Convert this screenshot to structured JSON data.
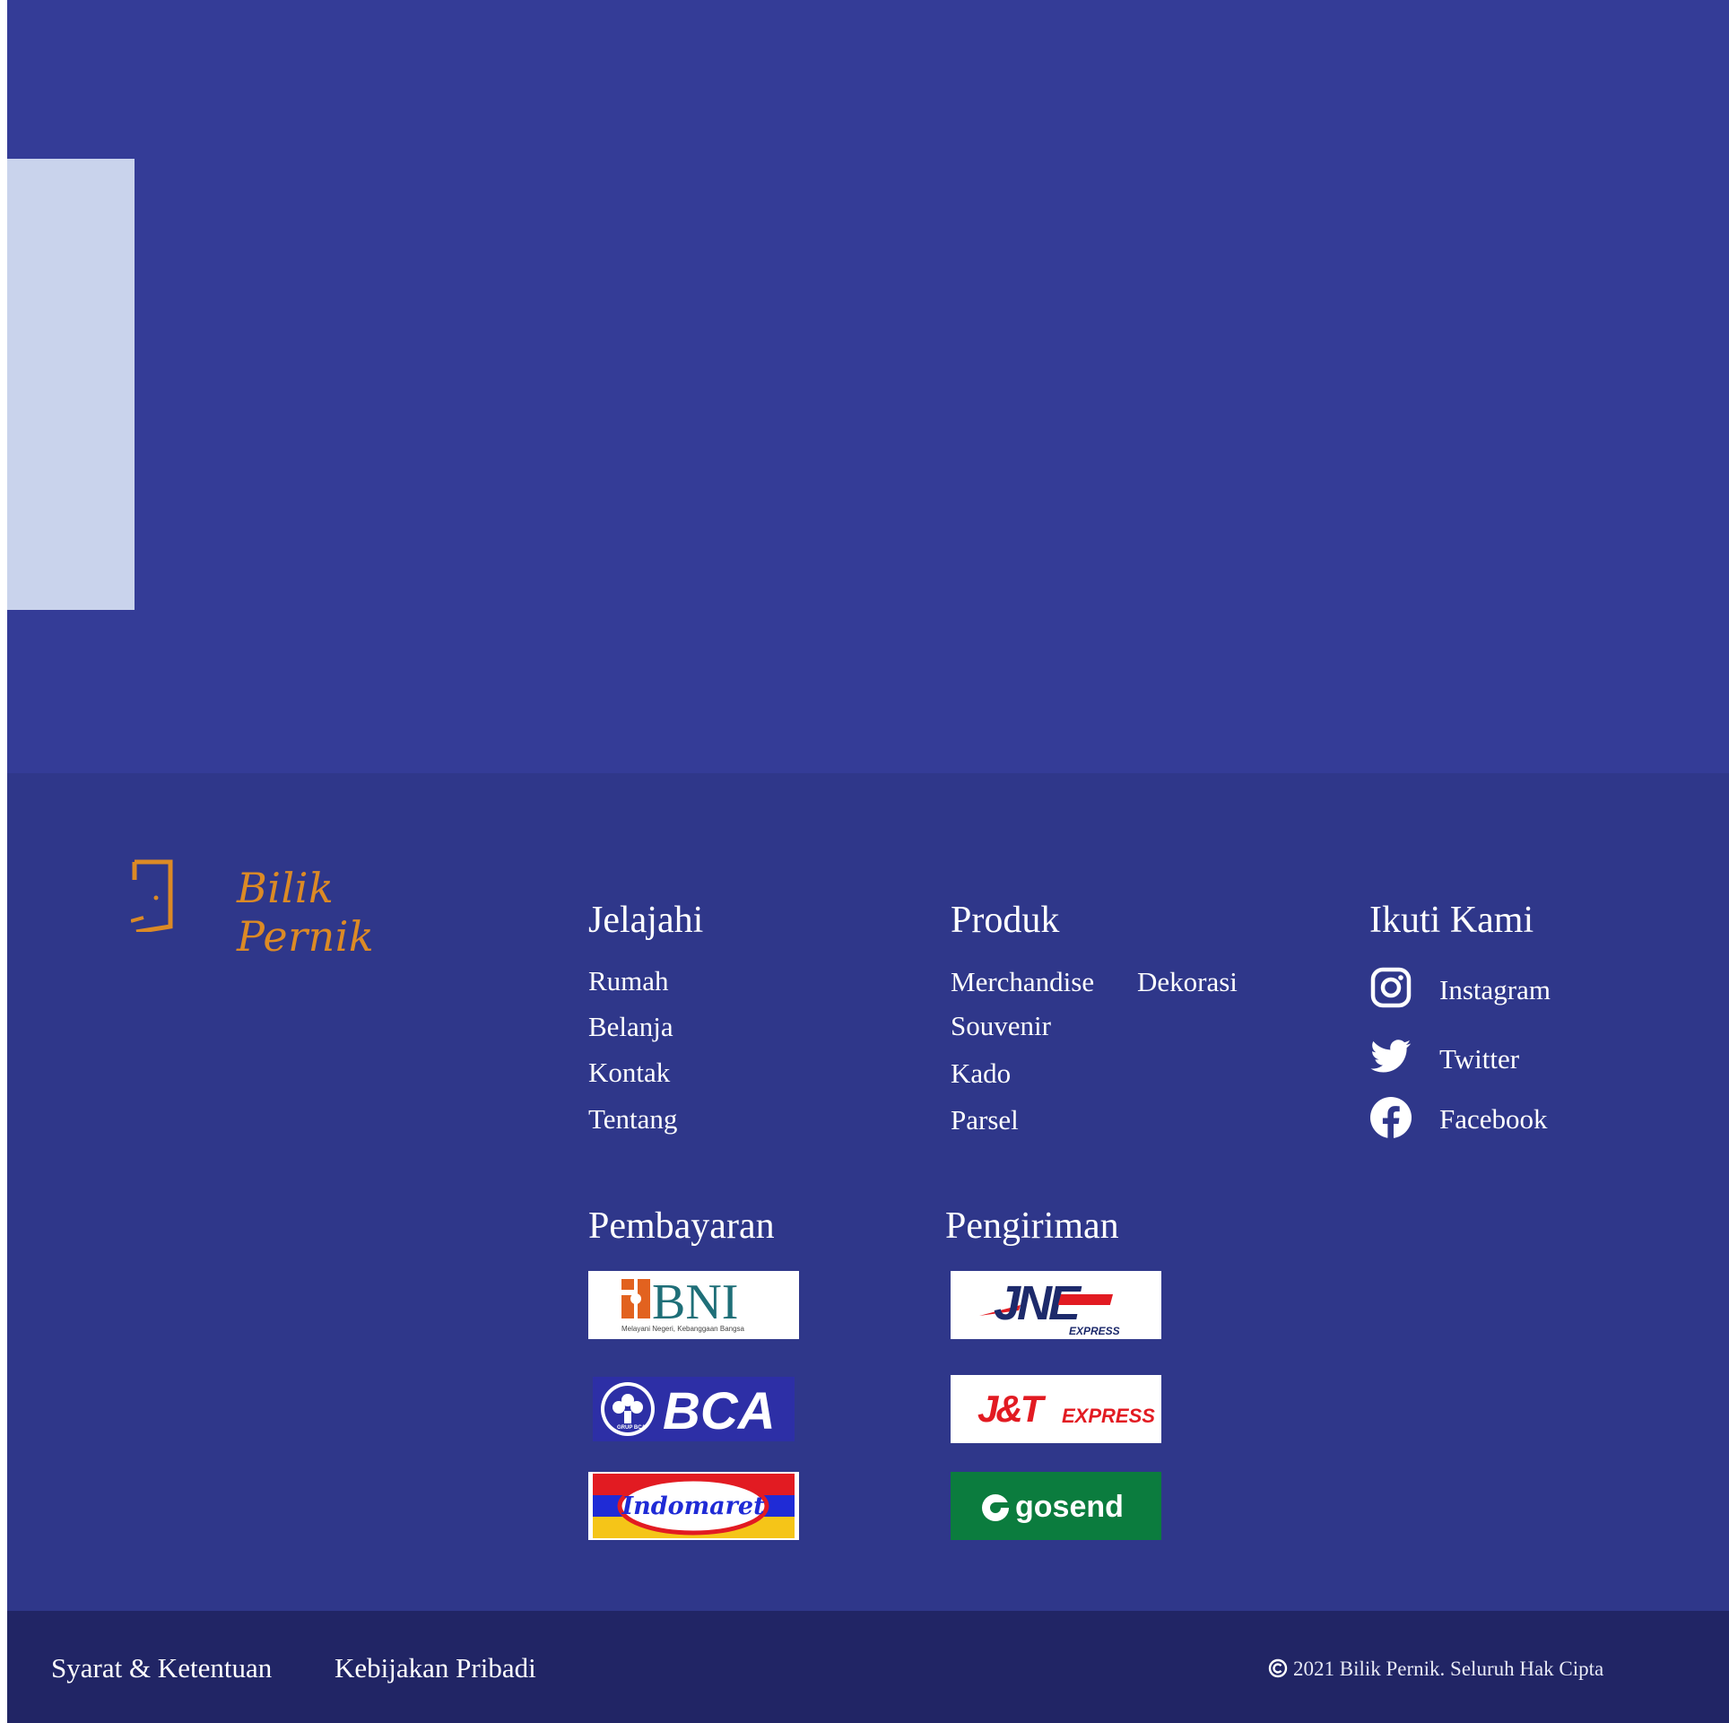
{
  "brand": {
    "name": "Bilik Pernik",
    "accent_color": "#dc8a25",
    "logo_icon": "door-icon"
  },
  "colors": {
    "hero_bg": "#343c97",
    "hero_panel": "#c9d3ec",
    "footer_bg": "#2f378a",
    "bottom_bar_bg": "#212565"
  },
  "explore": {
    "title": "Jelajahi",
    "links": [
      "Rumah",
      "Belanja",
      "Kontak",
      "Tentang"
    ]
  },
  "products": {
    "title": "Produk",
    "links": [
      "Merchandise",
      "Dekorasi",
      "Souvenir",
      "Kado",
      "Parsel"
    ]
  },
  "social": {
    "title": "Ikuti Kami",
    "items": [
      {
        "label": "Instagram",
        "icon": "instagram-icon"
      },
      {
        "label": "Twitter",
        "icon": "twitter-icon"
      },
      {
        "label": "Facebook",
        "icon": "facebook-icon"
      }
    ]
  },
  "payment": {
    "title": "Pembayaran",
    "logos": [
      {
        "name": "BNI",
        "tagline": "Melayani Negeri, Kebanggaan Bangsa"
      },
      {
        "name": "BCA",
        "tagline": "GRUP BCA"
      },
      {
        "name": "Indomaret"
      }
    ]
  },
  "shipping": {
    "title": "Pengiriman",
    "logos": [
      {
        "name": "JNE",
        "tagline": "EXPRESS"
      },
      {
        "name": "J&T",
        "tagline": "EXPRESS"
      },
      {
        "name": "gosend"
      }
    ]
  },
  "bottom": {
    "terms": "Syarat & Ketentuan",
    "privacy": "Kebijakan Pribadi",
    "copyright": "2021 Bilik Pernik. Seluruh Hak Cipta"
  }
}
